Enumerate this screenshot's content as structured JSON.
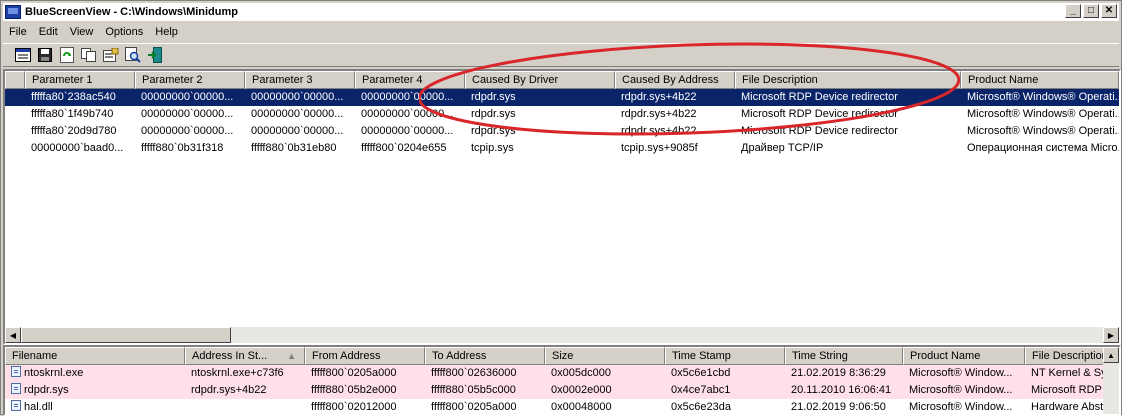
{
  "window": {
    "title": "BlueScreenView  -  C:\\Windows\\Minidump",
    "min_glyph": "_",
    "max_glyph": "□",
    "close_glyph": "✕"
  },
  "menu": [
    "File",
    "Edit",
    "View",
    "Options",
    "Help"
  ],
  "toolbar": {
    "icons": [
      "html-report-icon",
      "save-icon",
      "refresh-icon",
      "copy-icon",
      "properties-icon",
      "find-icon",
      "exit-icon"
    ]
  },
  "upper": {
    "columns": [
      "Parameter 1",
      "Parameter 2",
      "Parameter 3",
      "Parameter 4",
      "Caused By Driver",
      "Caused By Address",
      "File Description",
      "Product Name"
    ],
    "rows": [
      [
        "fffffa80`238ac540",
        "00000000`00000...",
        "00000000`00000...",
        "00000000`00000...",
        "rdpdr.sys",
        "rdpdr.sys+4b22",
        "Microsoft RDP Device redirector",
        "Microsoft® Windows® Operati..."
      ],
      [
        "fffffa80`1f49b740",
        "00000000`00000...",
        "00000000`00000...",
        "00000000`00000...",
        "rdpdr.sys",
        "rdpdr.sys+4b22",
        "Microsoft RDP Device redirector",
        "Microsoft® Windows® Operati..."
      ],
      [
        "fffffa80`20d9d780",
        "00000000`00000...",
        "00000000`00000...",
        "00000000`00000...",
        "rdpdr.sys",
        "rdpdr.sys+4b22",
        "Microsoft RDP Device redirector",
        "Microsoft® Windows® Operati..."
      ],
      [
        "00000000`baad0...",
        "fffff880`0b31f318",
        "fffff880`0b31eb80",
        "fffff800`0204e655",
        "tcpip.sys",
        "tcpip.sys+9085f",
        "Драйвер TCP/IP",
        "Операционная система Micro..."
      ]
    ],
    "selected_row": 0
  },
  "lower": {
    "columns": [
      "Filename",
      "Address In St...",
      "From Address",
      "To Address",
      "Size",
      "Time Stamp",
      "Time String",
      "Product Name",
      "File Description"
    ],
    "sort_glyph": "▲",
    "rows": [
      [
        "ntoskrnl.exe",
        "ntoskrnl.exe+c73f6",
        "fffff800`0205a000",
        "fffff800`02636000",
        "0x005dc000",
        "0x5c6e1cbd",
        "21.02.2019 8:36:29",
        "Microsoft® Window...",
        "NT Kernel & Sys"
      ],
      [
        "rdpdr.sys",
        "rdpdr.sys+4b22",
        "fffff880`05b2e000",
        "fffff880`05b5c000",
        "0x0002e000",
        "0x4ce7abc1",
        "20.11.2010 16:06:41",
        "Microsoft® Window...",
        "Microsoft RDP D"
      ],
      [
        "hal.dll",
        "",
        "fffff800`02012000",
        "fffff800`0205a000",
        "0x00048000",
        "0x5c6e23da",
        "21.02.2019 9:06:50",
        "Microsoft® Window...",
        "Hardware Abst"
      ]
    ],
    "pink_rows": [
      0,
      1
    ]
  },
  "colors": {
    "selection": "#0a246a",
    "highlight_row": "#ffe0e8",
    "annotation": "#d9262b"
  }
}
